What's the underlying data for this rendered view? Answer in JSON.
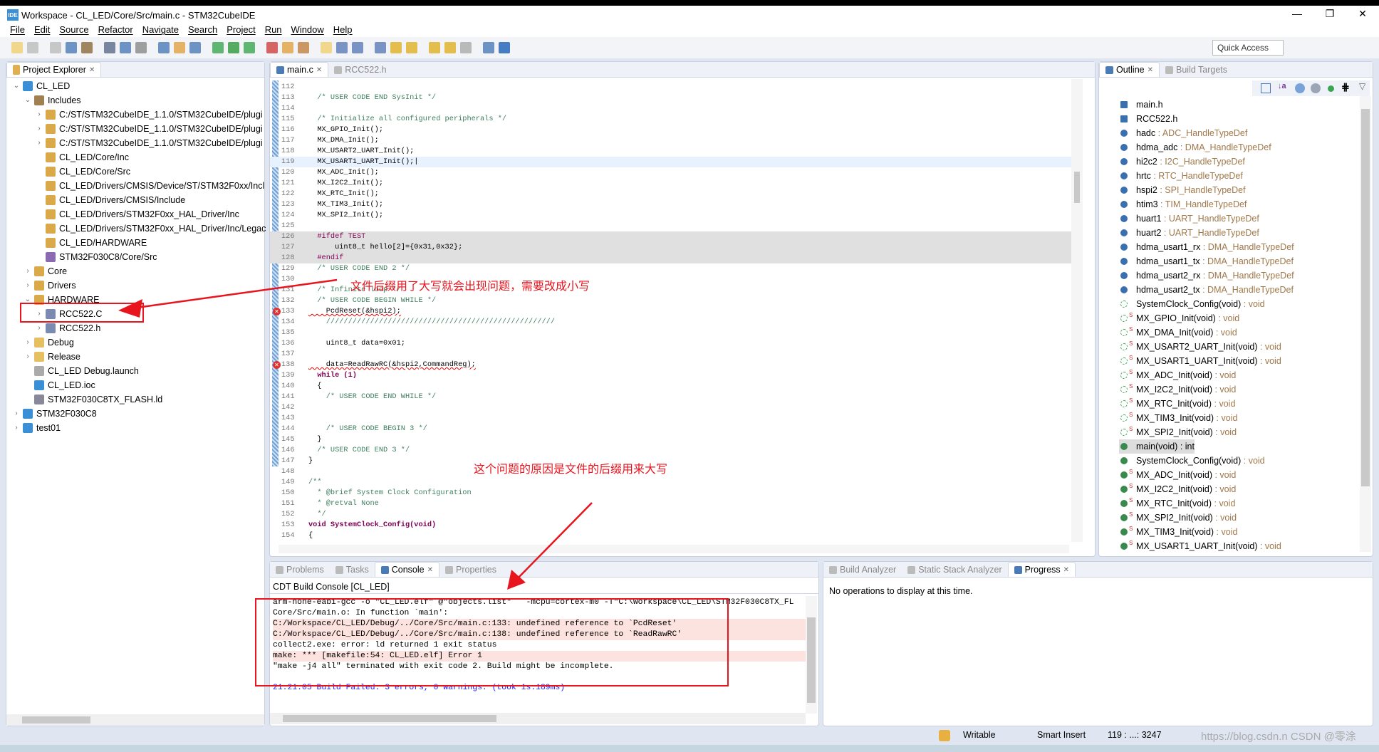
{
  "window": {
    "title": "Workspace - CL_LED/Core/Src/main.c - STM32CubeIDE",
    "logo": "IDE",
    "controls": [
      "—",
      "❐",
      "✕"
    ]
  },
  "menu": [
    "File",
    "Edit",
    "Source",
    "Refactor",
    "Navigate",
    "Search",
    "Project",
    "Run",
    "Window",
    "Help"
  ],
  "toolbar": {
    "quick_access_placeholder": "Quick Access"
  },
  "explorer": {
    "tab": "Project Explorer",
    "rows": [
      {
        "label": "CL_LED",
        "depth": 0,
        "twisty": "v",
        "icon": "project"
      },
      {
        "label": "Includes",
        "depth": 1,
        "twisty": "v",
        "icon": "includes"
      },
      {
        "label": "C:/ST/STM32CubeIDE_1.1.0/STM32CubeIDE/plugi",
        "depth": 2,
        "twisty": ">",
        "icon": "include-folder"
      },
      {
        "label": "C:/ST/STM32CubeIDE_1.1.0/STM32CubeIDE/plugi",
        "depth": 2,
        "twisty": ">",
        "icon": "include-folder"
      },
      {
        "label": "C:/ST/STM32CubeIDE_1.1.0/STM32CubeIDE/plugi",
        "depth": 2,
        "twisty": ">",
        "icon": "include-folder"
      },
      {
        "label": "CL_LED/Core/Inc",
        "depth": 2,
        "twisty": "",
        "icon": "include-folder"
      },
      {
        "label": "CL_LED/Core/Src",
        "depth": 2,
        "twisty": "",
        "icon": "include-folder"
      },
      {
        "label": "CL_LED/Drivers/CMSIS/Device/ST/STM32F0xx/Incl",
        "depth": 2,
        "twisty": "",
        "icon": "include-folder"
      },
      {
        "label": "CL_LED/Drivers/CMSIS/Include",
        "depth": 2,
        "twisty": "",
        "icon": "include-folder"
      },
      {
        "label": "CL_LED/Drivers/STM32F0xx_HAL_Driver/Inc",
        "depth": 2,
        "twisty": "",
        "icon": "include-folder"
      },
      {
        "label": "CL_LED/Drivers/STM32F0xx_HAL_Driver/Inc/Legac",
        "depth": 2,
        "twisty": "",
        "icon": "include-folder"
      },
      {
        "label": "CL_LED/HARDWARE",
        "depth": 2,
        "twisty": "",
        "icon": "include-folder"
      },
      {
        "label": "STM32F030C8/Core/Src",
        "depth": 2,
        "twisty": "",
        "icon": "project-include"
      },
      {
        "label": "Core",
        "depth": 1,
        "twisty": ">",
        "icon": "source-folder-error"
      },
      {
        "label": "Drivers",
        "depth": 1,
        "twisty": ">",
        "icon": "source-folder"
      },
      {
        "label": "HARDWARE",
        "depth": 1,
        "twisty": "v",
        "icon": "source-folder"
      },
      {
        "label": "RCC522.C",
        "depth": 2,
        "twisty": ">",
        "icon": "c-file"
      },
      {
        "label": "RCC522.h",
        "depth": 2,
        "twisty": ">",
        "icon": "h-file"
      },
      {
        "label": "Debug",
        "depth": 1,
        "twisty": ">",
        "icon": "folder"
      },
      {
        "label": "Release",
        "depth": 1,
        "twisty": ">",
        "icon": "folder"
      },
      {
        "label": "CL_LED Debug.launch",
        "depth": 1,
        "twisty": "",
        "icon": "launch-file"
      },
      {
        "label": "CL_LED.ioc",
        "depth": 1,
        "twisty": "",
        "icon": "mx-file"
      },
      {
        "label": "STM32F030C8TX_FLASH.ld",
        "depth": 1,
        "twisty": "",
        "icon": "ld-file"
      },
      {
        "label": "STM32F030C8",
        "depth": 0,
        "twisty": ">",
        "icon": "project"
      },
      {
        "label": "test01",
        "depth": 0,
        "twisty": ">",
        "icon": "project"
      }
    ]
  },
  "editor": {
    "tabs": [
      {
        "label": "main.c",
        "active": true
      },
      {
        "label": "RCC522.h",
        "active": false
      }
    ],
    "lines": [
      {
        "n": "112",
        "text": "",
        "kind": "code"
      },
      {
        "n": "113",
        "text": "  /* USER CODE END SysInit */",
        "kind": "comment"
      },
      {
        "n": "114",
        "text": "",
        "kind": "code"
      },
      {
        "n": "115",
        "text": "  /* Initialize all configured peripherals */",
        "kind": "comment"
      },
      {
        "n": "116",
        "text": "  MX_GPIO_Init();",
        "kind": "code"
      },
      {
        "n": "117",
        "text": "  MX_DMA_Init();",
        "kind": "code"
      },
      {
        "n": "118",
        "text": "  MX_USART2_UART_Init();",
        "kind": "code"
      },
      {
        "n": "119",
        "text": "  MX_USART1_UART_Init();|",
        "kind": "current"
      },
      {
        "n": "120",
        "text": "  MX_ADC_Init();",
        "kind": "code"
      },
      {
        "n": "121",
        "text": "  MX_I2C2_Init();",
        "kind": "code"
      },
      {
        "n": "122",
        "text": "  MX_RTC_Init();",
        "kind": "code"
      },
      {
        "n": "123",
        "text": "  MX_TIM3_Init();",
        "kind": "code"
      },
      {
        "n": "124",
        "text": "  MX_SPI2_Init();",
        "kind": "code"
      },
      {
        "n": "125",
        "text": "",
        "kind": "code"
      },
      {
        "n": "126",
        "text": "  #ifdef TEST",
        "kind": "inactive-pre"
      },
      {
        "n": "127",
        "text": "      uint8_t hello[2]={0x31,0x32};",
        "kind": "inactive"
      },
      {
        "n": "128",
        "text": "  #endif",
        "kind": "inactive-pre"
      },
      {
        "n": "129",
        "text": "  /* USER CODE END 2 */",
        "kind": "comment"
      },
      {
        "n": "130",
        "text": "",
        "kind": "code"
      },
      {
        "n": "131",
        "text": "  /* Infinite loop */",
        "kind": "comment"
      },
      {
        "n": "132",
        "text": "  /* USER CODE BEGIN WHILE */",
        "kind": "comment"
      },
      {
        "n": "133",
        "text": "    PcdReset(&hspi2);",
        "kind": "error"
      },
      {
        "n": "134",
        "text": "    ////////////////////////////////////////////////////",
        "kind": "comment"
      },
      {
        "n": "135",
        "text": "",
        "kind": "code"
      },
      {
        "n": "136",
        "text": "    uint8_t data=0x01;",
        "kind": "code"
      },
      {
        "n": "137",
        "text": "",
        "kind": "code"
      },
      {
        "n": "138",
        "text": "    data=ReadRawRC(&hspi2,CommandReg);",
        "kind": "error"
      },
      {
        "n": "139",
        "text": "  while (1)",
        "kind": "kw"
      },
      {
        "n": "140",
        "text": "  {",
        "kind": "code"
      },
      {
        "n": "141",
        "text": "    /* USER CODE END WHILE */",
        "kind": "comment"
      },
      {
        "n": "142",
        "text": "",
        "kind": "code"
      },
      {
        "n": "143",
        "text": "",
        "kind": "code"
      },
      {
        "n": "144",
        "text": "    /* USER CODE BEGIN 3 */",
        "kind": "comment"
      },
      {
        "n": "145",
        "text": "  }",
        "kind": "code"
      },
      {
        "n": "146",
        "text": "  /* USER CODE END 3 */",
        "kind": "comment"
      },
      {
        "n": "147",
        "text": "}",
        "kind": "code"
      },
      {
        "n": "148",
        "text": "",
        "kind": "code"
      },
      {
        "n": "149",
        "text": "/**",
        "kind": "comment"
      },
      {
        "n": "150",
        "text": "  * @brief System Clock Configuration",
        "kind": "comment"
      },
      {
        "n": "151",
        "text": "  * @retval None",
        "kind": "comment"
      },
      {
        "n": "152",
        "text": "  */",
        "kind": "comment"
      },
      {
        "n": "153",
        "text": "void SystemClock_Config(void)",
        "kind": "kw"
      },
      {
        "n": "154",
        "text": "{",
        "kind": "code"
      }
    ]
  },
  "outline": {
    "tabs": [
      {
        "label": "Outline",
        "active": true
      },
      {
        "label": "Build Targets",
        "active": false
      }
    ],
    "items": [
      {
        "name": "main.h",
        "type": "",
        "icon": "include"
      },
      {
        "name": "RCC522.h",
        "type": "",
        "icon": "include"
      },
      {
        "name": "hadc",
        "type": " : ADC_HandleTypeDef",
        "icon": "variable"
      },
      {
        "name": "hdma_adc",
        "type": " : DMA_HandleTypeDef",
        "icon": "variable"
      },
      {
        "name": "hi2c2",
        "type": " : I2C_HandleTypeDef",
        "icon": "variable"
      },
      {
        "name": "hrtc",
        "type": " : RTC_HandleTypeDef",
        "icon": "variable"
      },
      {
        "name": "hspi2",
        "type": " : SPI_HandleTypeDef",
        "icon": "variable"
      },
      {
        "name": "htim3",
        "type": " : TIM_HandleTypeDef",
        "icon": "variable"
      },
      {
        "name": "huart1",
        "type": " : UART_HandleTypeDef",
        "icon": "variable"
      },
      {
        "name": "huart2",
        "type": " : UART_HandleTypeDef",
        "icon": "variable"
      },
      {
        "name": "hdma_usart1_rx",
        "type": " : DMA_HandleTypeDef",
        "icon": "variable"
      },
      {
        "name": "hdma_usart1_tx",
        "type": " : DMA_HandleTypeDef",
        "icon": "variable"
      },
      {
        "name": "hdma_usart2_rx",
        "type": " : DMA_HandleTypeDef",
        "icon": "variable"
      },
      {
        "name": "hdma_usart2_tx",
        "type": " : DMA_HandleTypeDef",
        "icon": "variable"
      },
      {
        "name": "SystemClock_Config(void)",
        "type": " : void",
        "icon": "declaration"
      },
      {
        "name": "MX_GPIO_Init(void)",
        "type": " : void",
        "icon": "static-declaration"
      },
      {
        "name": "MX_DMA_Init(void)",
        "type": " : void",
        "icon": "static-declaration"
      },
      {
        "name": "MX_USART2_UART_Init(void)",
        "type": " : void",
        "icon": "static-declaration"
      },
      {
        "name": "MX_USART1_UART_Init(void)",
        "type": " : void",
        "icon": "static-declaration"
      },
      {
        "name": "MX_ADC_Init(void)",
        "type": " : void",
        "icon": "static-declaration"
      },
      {
        "name": "MX_I2C2_Init(void)",
        "type": " : void",
        "icon": "static-declaration"
      },
      {
        "name": "MX_RTC_Init(void)",
        "type": " : void",
        "icon": "static-declaration"
      },
      {
        "name": "MX_TIM3_Init(void)",
        "type": " : void",
        "icon": "static-declaration"
      },
      {
        "name": "MX_SPI2_Init(void)",
        "type": " : void",
        "icon": "static-declaration"
      },
      {
        "name": "main(void) : int",
        "type": "",
        "icon": "function-error"
      },
      {
        "name": "SystemClock_Config(void)",
        "type": " : void",
        "icon": "function"
      },
      {
        "name": "MX_ADC_Init(void)",
        "type": " : void",
        "icon": "static-function"
      },
      {
        "name": "MX_I2C2_Init(void)",
        "type": " : void",
        "icon": "static-function"
      },
      {
        "name": "MX_RTC_Init(void)",
        "type": " : void",
        "icon": "static-function"
      },
      {
        "name": "MX_SPI2_Init(void)",
        "type": " : void",
        "icon": "static-function"
      },
      {
        "name": "MX_TIM3_Init(void)",
        "type": " : void",
        "icon": "static-function"
      },
      {
        "name": "MX_USART1_UART_Init(void)",
        "type": " : void",
        "icon": "static-function"
      }
    ]
  },
  "console": {
    "tabs": [
      {
        "label": "Problems",
        "active": false
      },
      {
        "label": "Tasks",
        "active": false
      },
      {
        "label": "Console",
        "active": true
      },
      {
        "label": "Properties",
        "active": false
      }
    ],
    "header": "CDT Build Console [CL_LED]",
    "lines": [
      {
        "text": "arm-none-eabi-gcc -o \"CL_LED.elf\" @\"objects.list\"   -mcpu=cortex-m0 -T\"C:\\Workspace\\CL_LED\\STM32F030C8TX_FL",
        "kind": "normal"
      },
      {
        "text": "Core/Src/main.o: In function `main':",
        "kind": "normal"
      },
      {
        "text": "C:/Workspace/CL_LED/Debug/../Core/Src/main.c:133: undefined reference to `PcdReset'",
        "kind": "error"
      },
      {
        "text": "C:/Workspace/CL_LED/Debug/../Core/Src/main.c:138: undefined reference to `ReadRawRC'",
        "kind": "error"
      },
      {
        "text": "collect2.exe: error: ld returned 1 exit status",
        "kind": "normal"
      },
      {
        "text": "make: *** [makefile:54: CL_LED.elf] Error 1",
        "kind": "error"
      },
      {
        "text": "\"make -j4 all\" terminated with exit code 2. Build might be incomplete.",
        "kind": "normal"
      },
      {
        "text": "",
        "kind": "normal"
      },
      {
        "text": "21:21:05 Build Failed. 3 errors, 0 warnings. (took 1s.189ms)",
        "kind": "info"
      }
    ]
  },
  "progress": {
    "tabs": [
      {
        "label": "Build Analyzer",
        "active": false
      },
      {
        "label": "Static Stack Analyzer",
        "active": false
      },
      {
        "label": "Progress",
        "active": true
      }
    ],
    "message": "No operations to display at this time."
  },
  "status": {
    "writable": "Writable",
    "insert_mode": "Smart Insert",
    "position": "119 : ...: 3247",
    "watermark": "https://blog.csdn.n CSDN @零涂"
  },
  "annotations": {
    "note1": "文件后缀用了大写就会出现问题，需要改成小写",
    "note2": "这个问题的原因是文件的后缀用来大写"
  },
  "colors": {
    "annotation": "#e8141e",
    "comment": "#3f7f5f",
    "keyword": "#7f0055",
    "console_error_bg": "#fde3df",
    "console_info": "#1a1aff"
  }
}
